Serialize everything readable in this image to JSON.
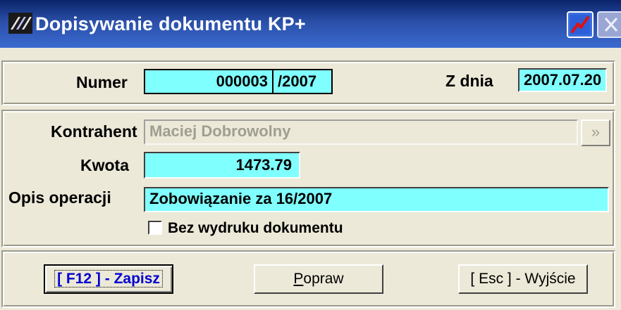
{
  "window": {
    "title": "Dopisywanie dokumentu KP+"
  },
  "header": {
    "numer_label": "Numer",
    "numer_value": "000003",
    "numer_suffix": "/2007",
    "date_label": "Z dnia",
    "date_value": "2007.07.20"
  },
  "form": {
    "kontrahent_label": "Kontrahent",
    "kontrahent_value": "Maciej Dobrowolny",
    "more_button": "»",
    "kwota_label": "Kwota",
    "kwota_value": "1473.79",
    "opis_label": "Opis operacji",
    "opis_value": "Zobowiązanie za 16/2007",
    "no_print_label": "Bez wydruku dokumentu"
  },
  "buttons": {
    "save": "[ F12 ] - Zapisz",
    "fix_first": "P",
    "fix_rest": "opraw",
    "exit": "[ Esc ] - Wyjście"
  },
  "colors": {
    "field_bg": "#80ffff",
    "title_bar": "#0a246a",
    "save_text": "#0000d0"
  }
}
